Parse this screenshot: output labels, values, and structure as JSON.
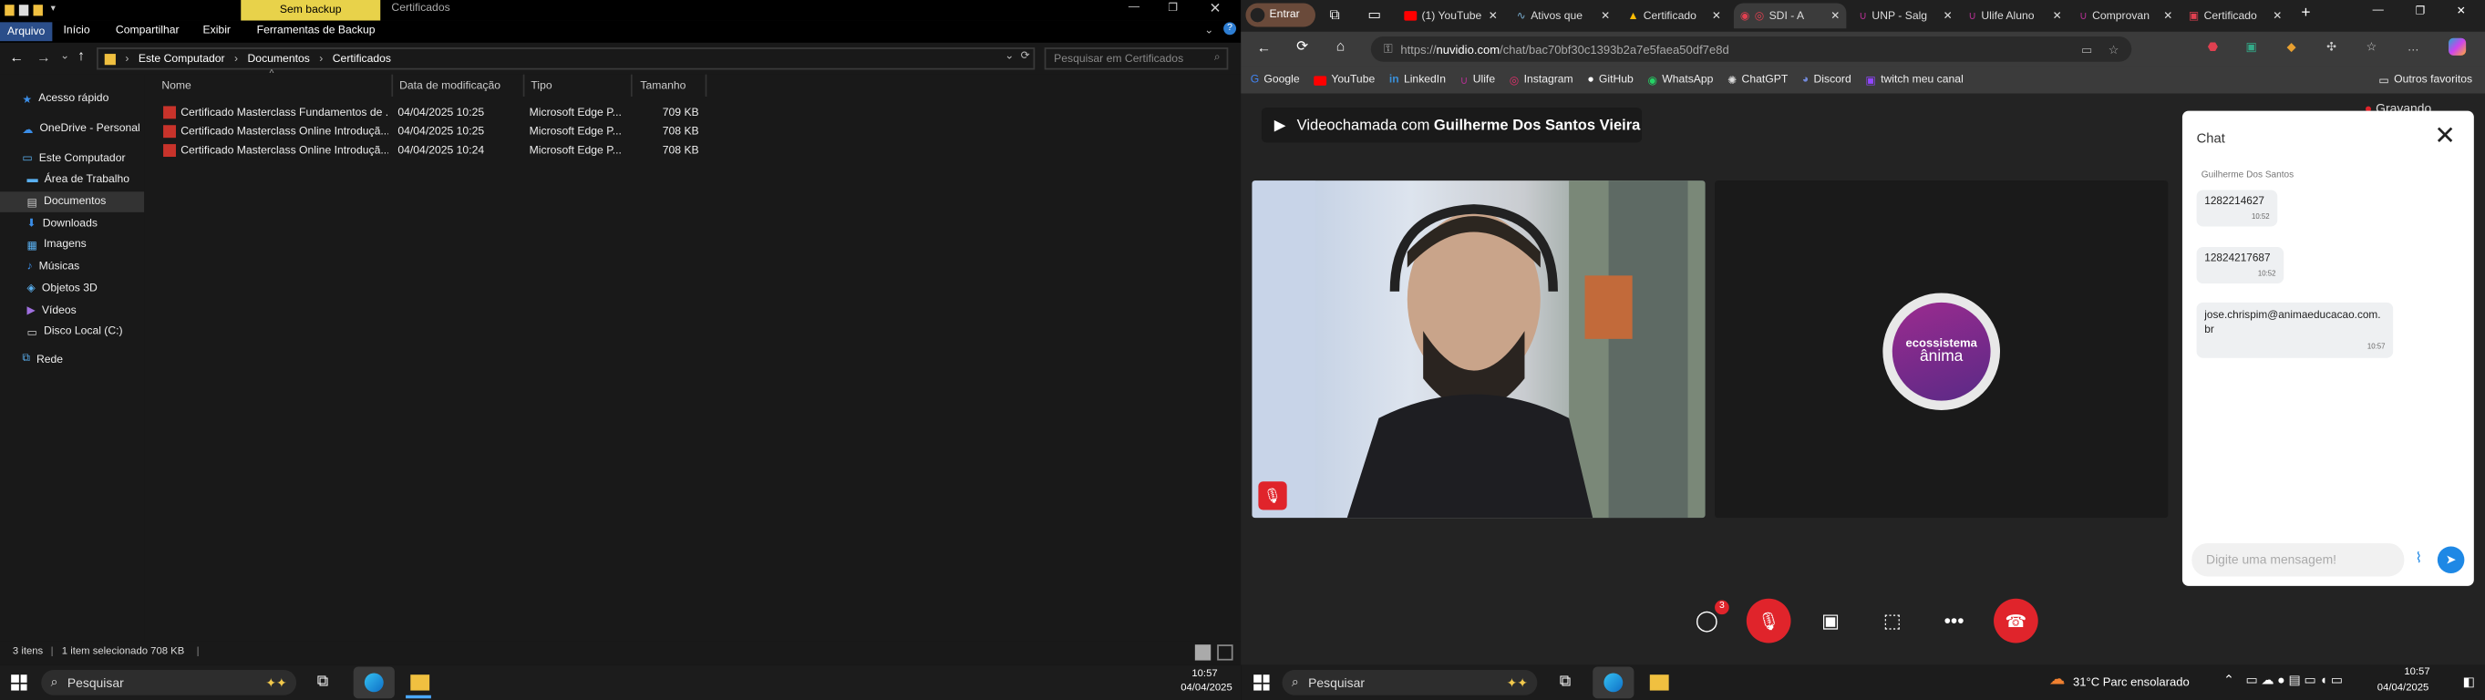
{
  "explorer": {
    "title_tabs": {
      "sem_backup": "Sem backup",
      "certificados": "Certificados"
    },
    "ribbon": [
      "Arquivo",
      "Início",
      "Compartilhar",
      "Exibir",
      "Ferramentas de Backup"
    ],
    "breadcrumb": [
      "Este Computador",
      "Documentos",
      "Certificados"
    ],
    "search_placeholder": "Pesquisar em Certificados",
    "nav": {
      "quick_access": "Acesso rápido",
      "onedrive": "OneDrive - Personal",
      "this_pc": "Este Computador",
      "items": [
        "Área de Trabalho",
        "Documentos",
        "Downloads",
        "Imagens",
        "Músicas",
        "Objetos 3D",
        "Vídeos",
        "Disco Local (C:)"
      ],
      "network": "Rede"
    },
    "columns": {
      "name": "Nome",
      "date": "Data de modificação",
      "type": "Tipo",
      "size": "Tamanho"
    },
    "files": [
      {
        "name": "Certificado Masterclass Fundamentos de ...",
        "date": "04/04/2025 10:25",
        "type": "Microsoft Edge P...",
        "size": "709 KB"
      },
      {
        "name": "Certificado Masterclass Online Introduçã...",
        "date": "04/04/2025 10:25",
        "type": "Microsoft Edge P...",
        "size": "708 KB"
      },
      {
        "name": "Certificado Masterclass Online Introduçã...",
        "date": "04/04/2025 10:24",
        "type": "Microsoft Edge P...",
        "size": "708 KB"
      }
    ],
    "status": {
      "count": "3 itens",
      "selected": "1 item selecionado  708 KB"
    }
  },
  "taskbar_left": {
    "search": "Pesquisar",
    "time": "10:57",
    "date": "04/04/2025"
  },
  "taskbar_right": {
    "search": "Pesquisar",
    "weather": "31°C  Parc ensolarado",
    "time": "10:57",
    "date": "04/04/2025"
  },
  "browser": {
    "profile": "Entrar",
    "tabs": [
      "(1) YouTube",
      "Ativos que",
      "Certificado",
      "SDI - A",
      "UNP - Salg",
      "Ulife Aluno",
      "Comprovan",
      "Certificado"
    ],
    "url_prefix": "https://",
    "url_domain": "nuvidio.com",
    "url_path": "/chat/bac70bf30c1393b2a7e5faea50df7e8d",
    "bookmarks": [
      "Google",
      "YouTube",
      "LinkedIn",
      "Ulife",
      "Instagram",
      "GitHub",
      "WhatsApp",
      "ChatGPT",
      "Discord",
      "twitch meu canal"
    ],
    "other_favorites": "Outros favoritos"
  },
  "call": {
    "title_prefix": "Videochamada com ",
    "caller": "Guilherme Dos Santos Vieira",
    "recording": "Gravando",
    "logo_line1": "ecossistema",
    "logo_line2": "ânima",
    "chat_badge": "3"
  },
  "chat": {
    "title": "Chat",
    "sender": "Guilherme Dos Santos",
    "messages": [
      {
        "text": "1282214627",
        "time": "10:52"
      },
      {
        "text": "12824217687",
        "time": "10:52"
      },
      {
        "text": "jose.chrispim@animaeducacao.com.br",
        "time": "10:57"
      }
    ],
    "input_placeholder": "Digite uma mensagem!"
  },
  "colors": {
    "accent_blue": "#1e88e5",
    "end_call_red": "#e0242b",
    "anima_purple": "#7b2b86"
  }
}
